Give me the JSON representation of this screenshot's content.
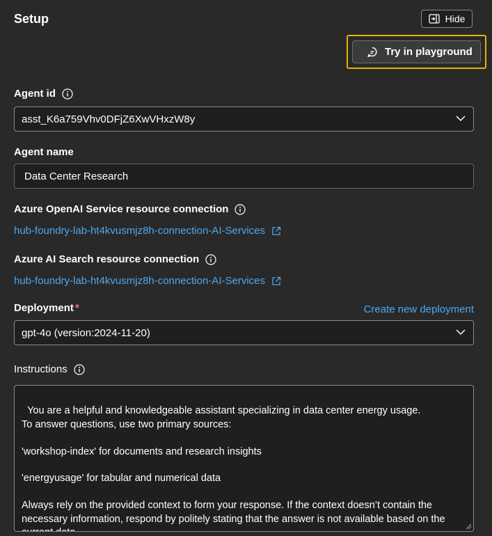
{
  "panel": {
    "title": "Setup"
  },
  "header": {
    "hide_label": "Hide",
    "try_label": "Try in playground"
  },
  "agent_id": {
    "label": "Agent id",
    "value": "asst_K6a759Vhv0DFjZ6XwVHxzW8y"
  },
  "agent_name": {
    "label": "Agent name",
    "value": "Data Center Research"
  },
  "openai_connection": {
    "label": "Azure OpenAI Service resource connection",
    "link": "hub-foundry-lab-ht4kvusmjz8h-connection-AI-Services"
  },
  "search_connection": {
    "label": "Azure AI Search resource connection",
    "link": "hub-foundry-lab-ht4kvusmjz8h-connection-AI-Services"
  },
  "deployment": {
    "label": "Deployment",
    "required_mark": "*",
    "create_link": "Create new deployment",
    "value": "gpt-4o (version:2024-11-20)"
  },
  "instructions": {
    "label": "Instructions",
    "value": "You are a helpful and knowledgeable assistant specializing in data center energy usage.\nTo answer questions, use two primary sources:\n\n'workshop-index' for documents and research insights\n\n'energyusage' for tabular and numerical data\n\nAlways rely on the provided context to form your response. If the context doesn’t contain the necessary information, respond by politely stating that the answer is not available based on the current data."
  },
  "colors": {
    "background": "#292929",
    "accent_link": "#4ea8ec",
    "highlight": "#e3b400",
    "required": "#ff6a6a"
  }
}
